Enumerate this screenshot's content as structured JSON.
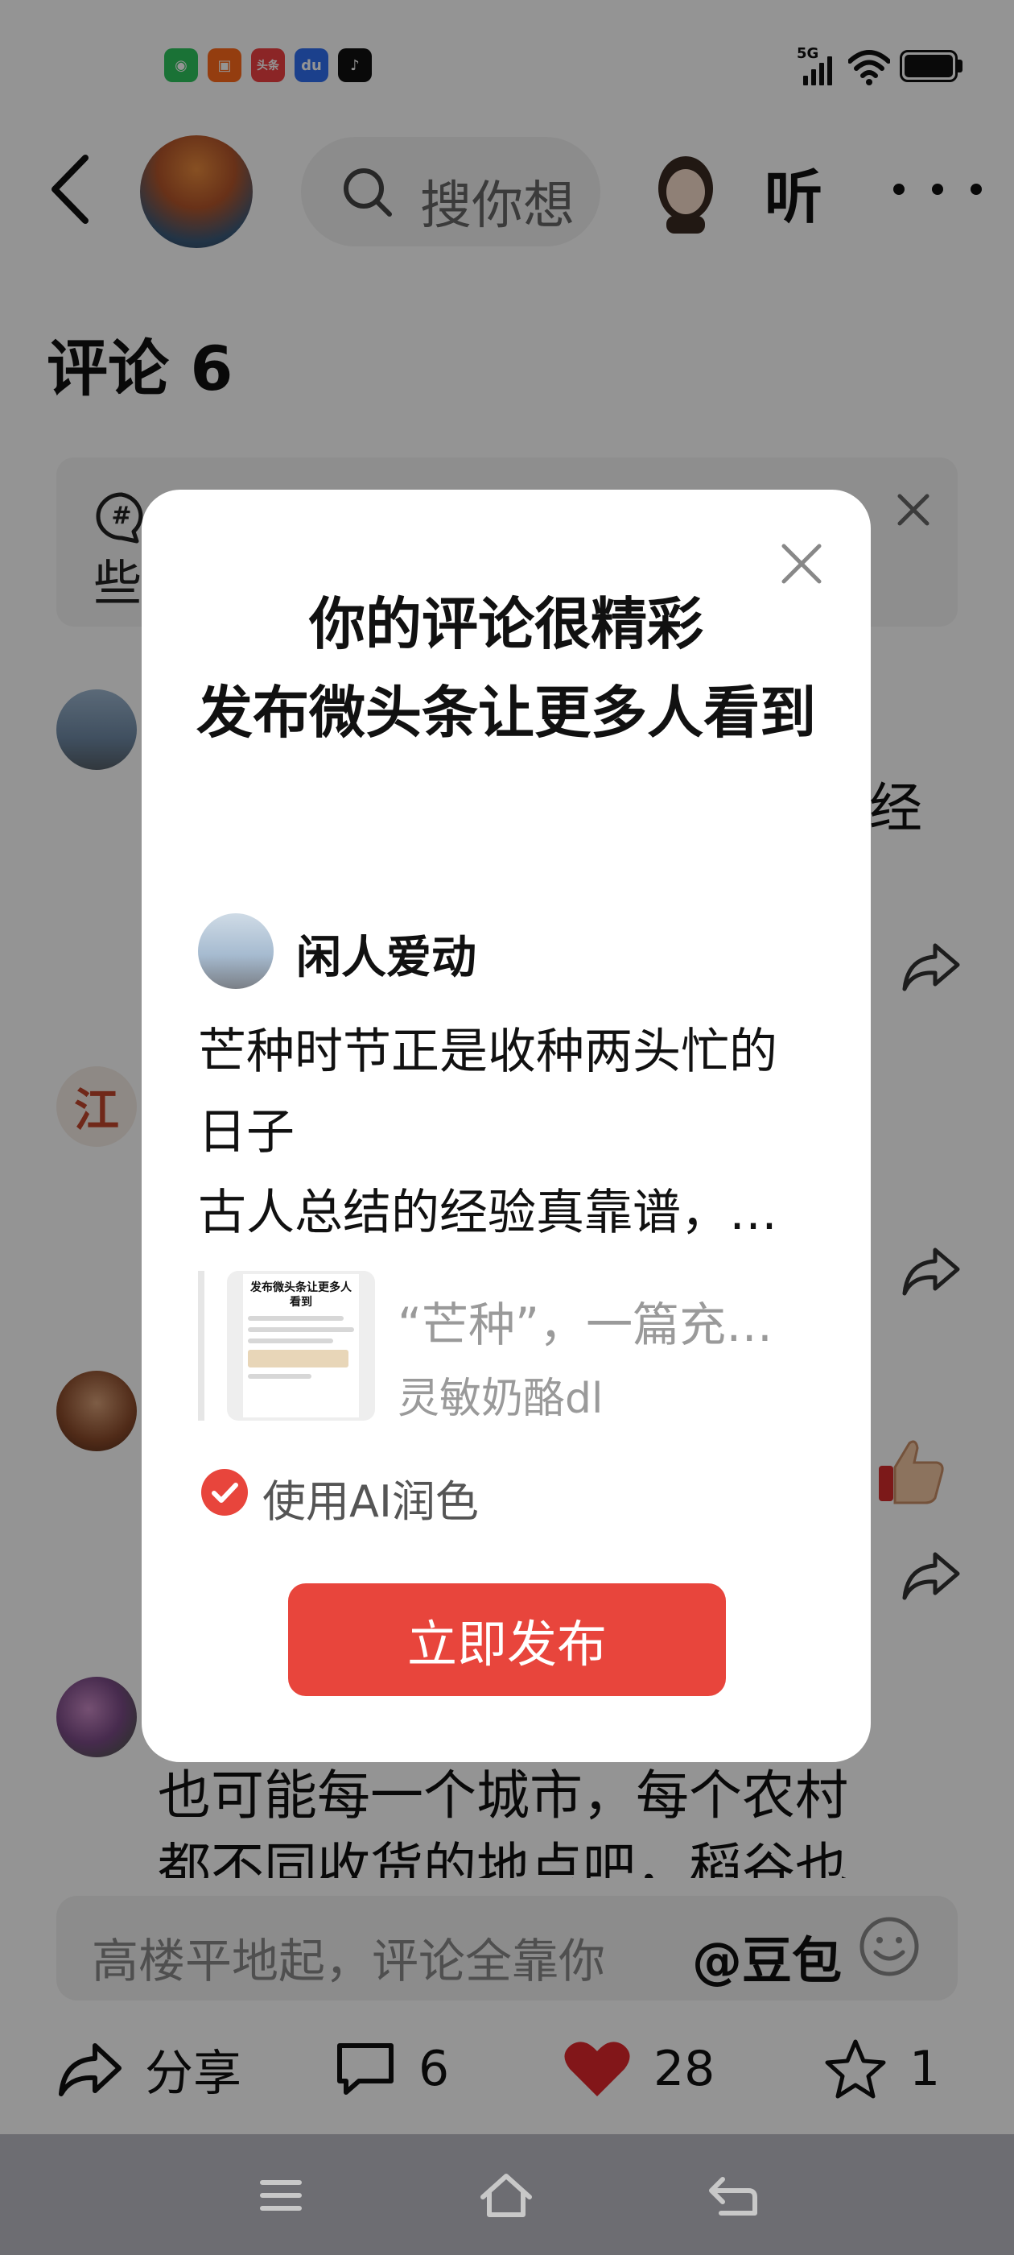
{
  "status_bar": {
    "network": "5G",
    "apps": [
      {
        "icon": "wechat-icon",
        "color": "#2dc55e",
        "glyph": "◉"
      },
      {
        "icon": "kuaishou-icon",
        "color": "#ff6a1a",
        "glyph": "▣"
      },
      {
        "icon": "toutiao-icon",
        "color": "#f04142",
        "glyph": "头条"
      },
      {
        "icon": "baidu-icon",
        "color": "#2f6ef2",
        "glyph": "du"
      },
      {
        "icon": "douyin-icon",
        "color": "#111111",
        "glyph": "♪"
      }
    ]
  },
  "header": {
    "search_placeholder": "搜你想",
    "listen_label": "听"
  },
  "comments": {
    "title": "评论 6",
    "topic_hint": "些",
    "visible_tail": "经",
    "partial_comment_lines": [
      "也可能每一个城市，每个农村",
      "都不同收货的地点吧，稻谷也"
    ]
  },
  "input_bar": {
    "placeholder": "高楼平地起，评论全靠你",
    "mention_label": "@豆包"
  },
  "actions": {
    "share_label": "分享",
    "comment_count": "6",
    "like_count": "28",
    "favorite_count": "1"
  },
  "modal": {
    "title_line1": "你的评论很精彩",
    "title_line2": "发布微头条让更多人看到",
    "username": "闲人爱动",
    "body_line1": "芒种时节正是收种两头忙的日子",
    "body_line2": "古人总结的经验真靠谱，…",
    "article": {
      "thumb_title": "发布微头条让更多人看到",
      "title": "“芒种”，一篇充…",
      "author": "灵敏奶酪dl"
    },
    "ai_polish_label": "使用AI润色",
    "ai_polish_checked": true,
    "publish_label": "立即发布"
  },
  "colors": {
    "accent": "#e8453c",
    "like": "#e0262c",
    "overlay": "rgba(0,0,0,0.42)"
  }
}
